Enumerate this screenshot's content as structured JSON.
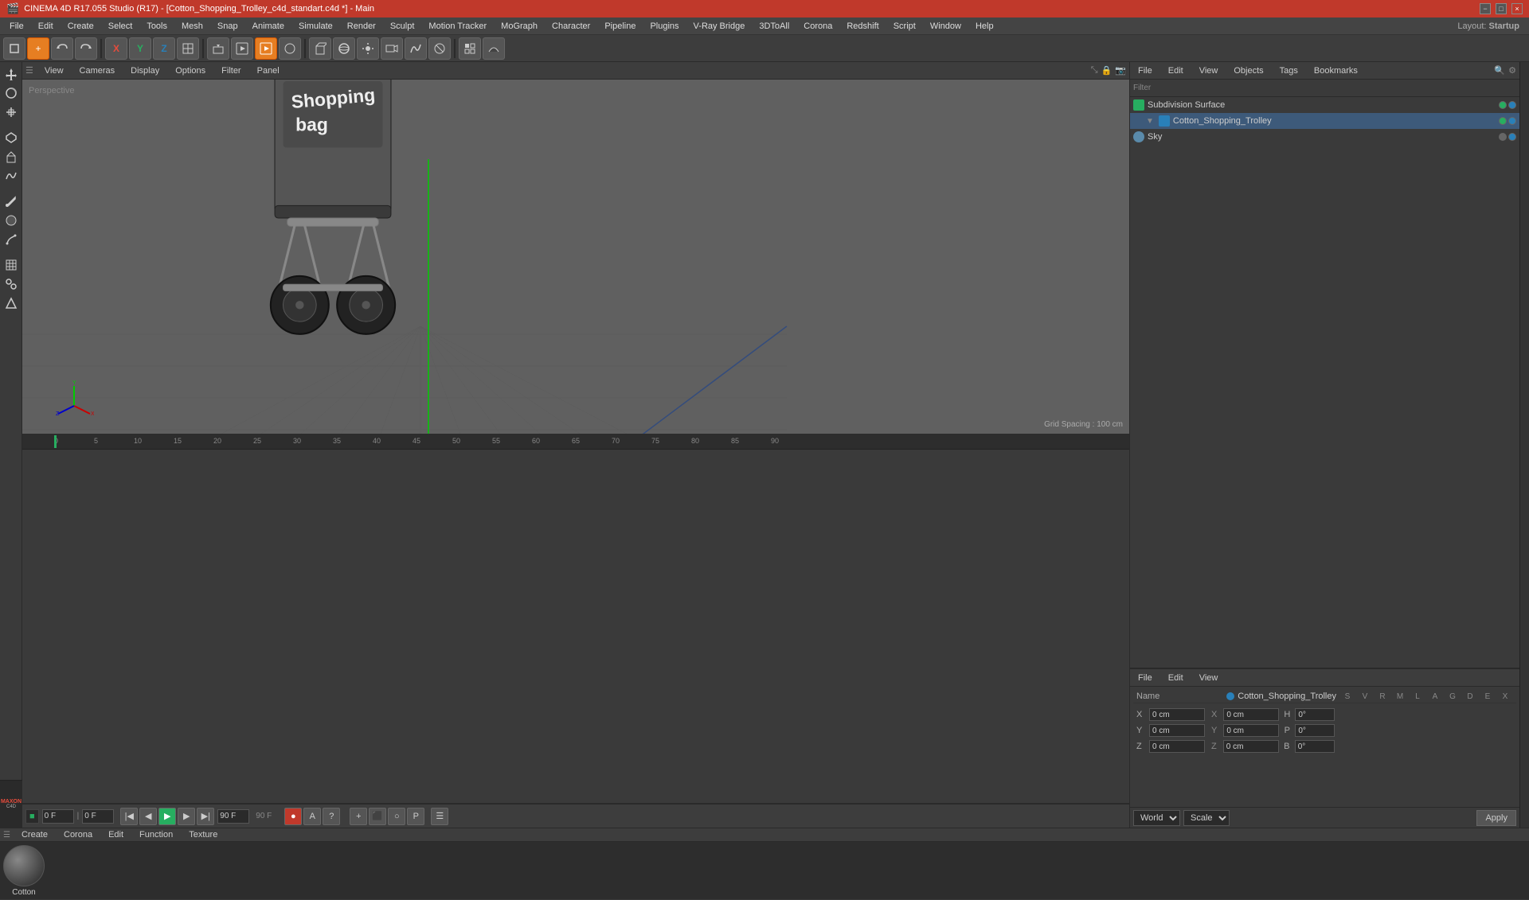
{
  "title_bar": {
    "title": "CINEMA 4D R17.055 Studio (R17) - [Cotton_Shopping_Trolley_c4d_standart.c4d *] - Main",
    "min_label": "−",
    "max_label": "□",
    "close_label": "×"
  },
  "layout": {
    "label": "Layout:",
    "value": "Startup"
  },
  "menu_bar": {
    "items": [
      "File",
      "Edit",
      "Create",
      "Select",
      "Tools",
      "Mesh",
      "Snap",
      "Animate",
      "Simulate",
      "Render",
      "Sculpt",
      "Motion Tracker",
      "MoGraph",
      "Character",
      "Pipeline",
      "Plugins",
      "V-Ray Bridge",
      "3DToAll",
      "Corona",
      "Redshift",
      "Script",
      "Window",
      "Help"
    ]
  },
  "viewport": {
    "label": "Perspective",
    "grid_spacing": "Grid Spacing : 100 cm",
    "menus": [
      "View",
      "Cameras",
      "Display",
      "Options",
      "Filter",
      "Panel"
    ]
  },
  "obj_manager": {
    "menus": [
      "File",
      "Edit",
      "View",
      "Objects",
      "Tags",
      "Bookmarks"
    ],
    "items": [
      {
        "name": "Subdivision Surface",
        "icon_color": "#3a7a3a",
        "dots": [
          "green",
          "blue"
        ]
      },
      {
        "name": "Cotton_Shopping_Trolley",
        "icon_color": "#3a7a7a",
        "dots": [
          "green",
          "blue"
        ],
        "indent": 12
      },
      {
        "name": "Sky",
        "icon_color": "#5a8aaa",
        "dots": [
          "grey",
          "blue"
        ]
      }
    ]
  },
  "attr_panel": {
    "menus": [
      "File",
      "Edit",
      "View"
    ],
    "name_label": "Name",
    "selected_name": "Cotton_Shopping_Trolley",
    "columns": [
      "S",
      "V",
      "R",
      "M",
      "L",
      "A",
      "G",
      "D",
      "E",
      "X"
    ],
    "rows": [
      {
        "label": "X",
        "val1": "0 cm",
        "eq": "X",
        "val2": "0 cm",
        "letter": "H",
        "angle": "0°"
      },
      {
        "label": "Y",
        "val1": "0 cm",
        "eq": "Y",
        "val2": "0 cm",
        "letter": "P",
        "angle": "0°"
      },
      {
        "label": "Z",
        "val1": "0 cm",
        "eq": "Z",
        "val2": "0 cm",
        "letter": "B",
        "angle": "0°"
      }
    ],
    "world_label": "World",
    "scale_label": "Scale",
    "apply_label": "Apply"
  },
  "timeline": {
    "ticks": [
      "0",
      "5",
      "10",
      "15",
      "20",
      "25",
      "30",
      "35",
      "40",
      "45",
      "50",
      "55",
      "60",
      "65",
      "70",
      "75",
      "80",
      "85",
      "90"
    ],
    "current_frame": "0 F",
    "start_frame": "0 F",
    "end_frame": "90 F",
    "fps_label": "90 F"
  },
  "material": {
    "menus": [
      "Create",
      "Corona",
      "Edit",
      "Function",
      "Texture"
    ],
    "items": [
      {
        "name": "Cotton",
        "ball_gradient": "radial-gradient(circle at 35% 35%, #888, #222)"
      }
    ]
  },
  "icons": {
    "move": "✛",
    "rotate": "↻",
    "scale": "⤢",
    "play": "▶",
    "stop": "◼",
    "rewind": "◀◀",
    "forward": "▶▶",
    "record": "●"
  }
}
